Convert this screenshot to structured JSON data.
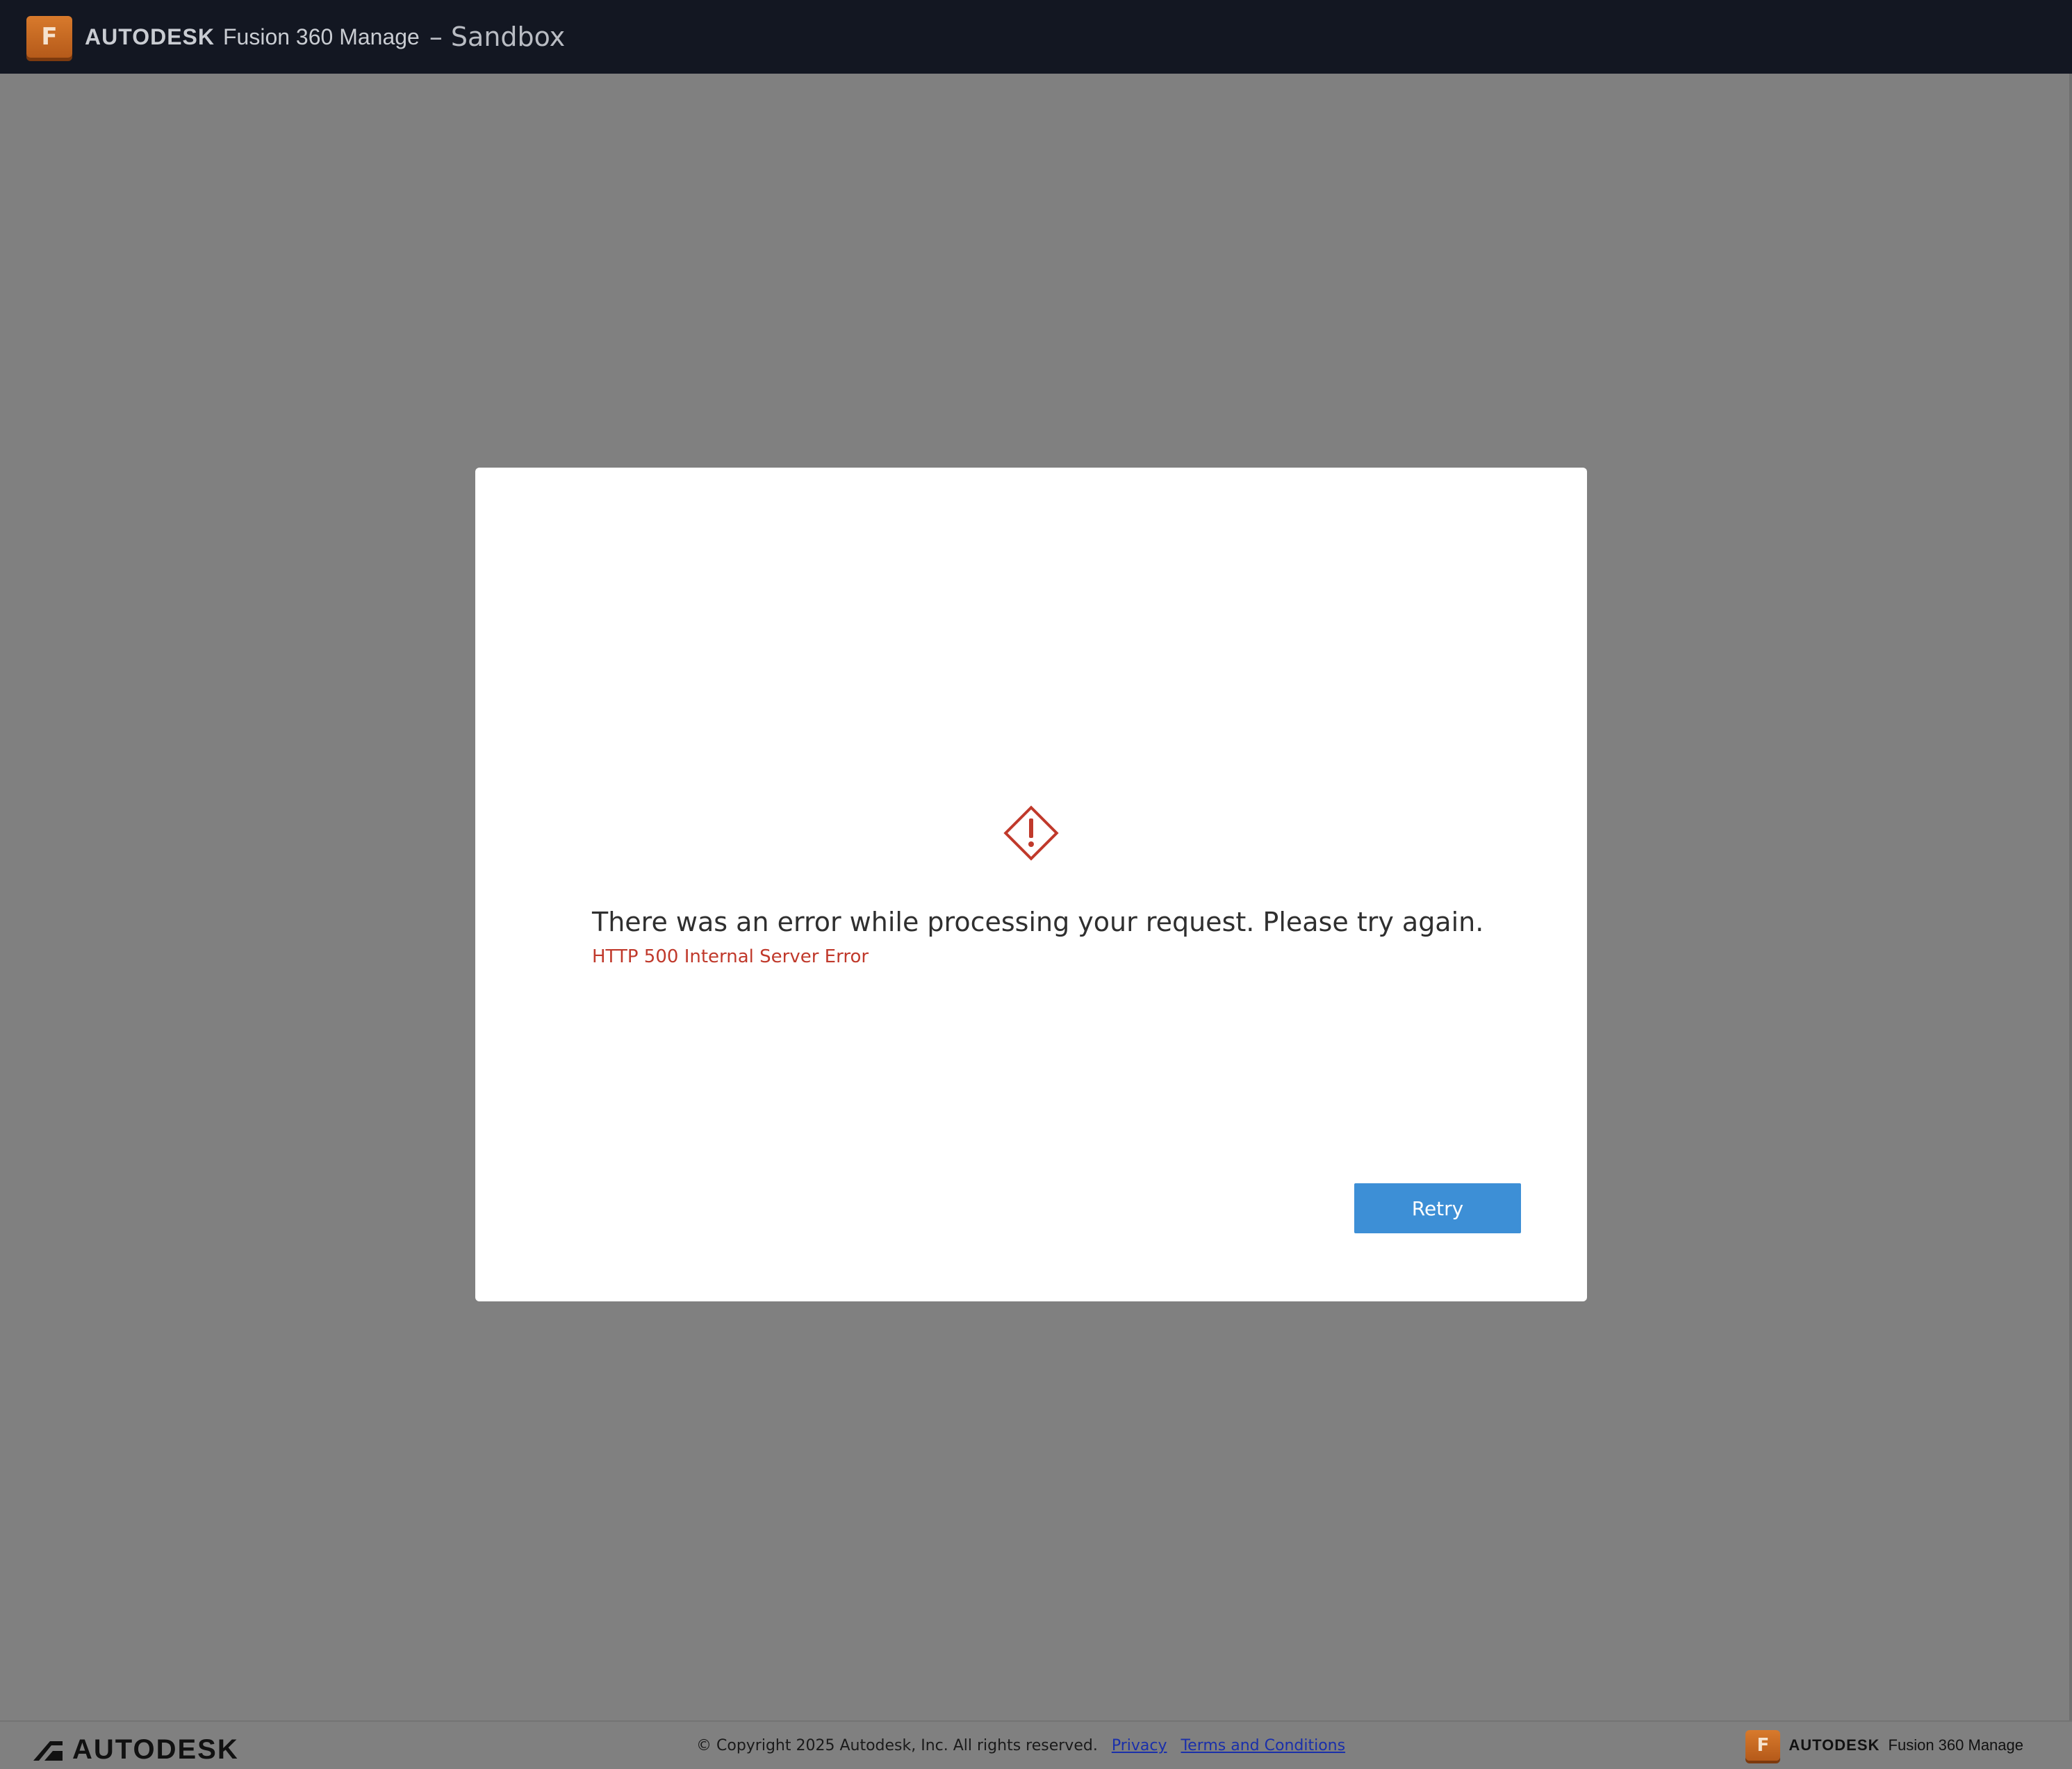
{
  "header": {
    "logo_letter": "F",
    "brand_company": "AUTODESK",
    "brand_product": "Fusion 360 Manage",
    "environment": "– Sandbox"
  },
  "dialog": {
    "message": "There was an error while processing your request. Please try again.",
    "detail": "HTTP 500 Internal Server Error",
    "retry_label": "Retry",
    "icon": "warning-diamond-icon",
    "accent_color": "#c0392b",
    "button_color": "#3d8fd6"
  },
  "footer": {
    "company": "AUTODESK",
    "copyright": "© Copyright 2025 Autodesk, Inc. All rights reserved.",
    "privacy_label": "Privacy",
    "terms_label": "Terms and Conditions",
    "product_logo_letter": "F",
    "product_company": "AUTODESK",
    "product_name": "Fusion 360 Manage"
  }
}
